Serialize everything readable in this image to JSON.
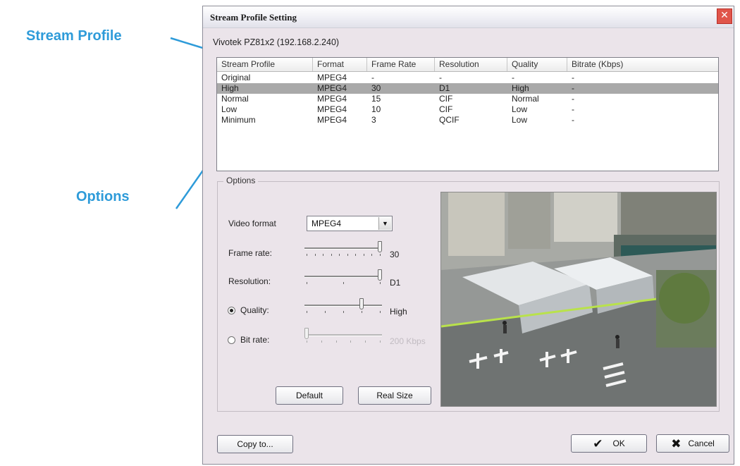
{
  "callouts": {
    "stream_profile": "Stream Profile",
    "options": "Options"
  },
  "dialog": {
    "title": "Stream Profile Setting",
    "close_glyph": "✕",
    "device_label": "Vivotek PZ81x2 (192.168.2.240)"
  },
  "profile_table": {
    "headers": [
      "Stream Profile",
      "Format",
      "Frame Rate",
      "Resolution",
      "Quality",
      "Bitrate (Kbps)"
    ],
    "rows": [
      [
        "Original",
        "MPEG4",
        "-",
        "-",
        "-",
        "-"
      ],
      [
        "High",
        "MPEG4",
        "30",
        "D1",
        "High",
        "-"
      ],
      [
        "Normal",
        "MPEG4",
        "15",
        "CIF",
        "Normal",
        "-"
      ],
      [
        "Low",
        "MPEG4",
        "10",
        "CIF",
        "Low",
        "-"
      ],
      [
        "Minimum",
        "MPEG4",
        "3",
        "QCIF",
        "Low",
        "-"
      ]
    ],
    "selected_row_index": 1,
    "selection_color": "#a9a9a9"
  },
  "options": {
    "group_title": "Options",
    "video_format": {
      "label": "Video format",
      "value": "MPEG4"
    },
    "frame_rate": {
      "label": "Frame rate:",
      "value_text": "30",
      "level": 1.0
    },
    "resolution": {
      "label": "Resolution:",
      "value_text": "D1",
      "level": 1.0
    },
    "quality": {
      "label": "Quality:",
      "value_text": "High",
      "level": 0.75,
      "selected": true
    },
    "bit_rate": {
      "label": "Bit rate:",
      "value_text": "200 Kbps",
      "level": 0.0,
      "selected": false,
      "enabled": false
    },
    "default_button": "Default",
    "real_size_button": "Real Size"
  },
  "footer": {
    "copy_button": "Copy to...",
    "ok_button": "OK",
    "ok_icon": "checkmark-icon",
    "cancel_button": "Cancel",
    "cancel_icon": "x-mark-icon"
  },
  "colors": {
    "accent": "#2e9bd9",
    "dialog_bg": "#ebe4ea",
    "close_button": "#e0554a"
  }
}
